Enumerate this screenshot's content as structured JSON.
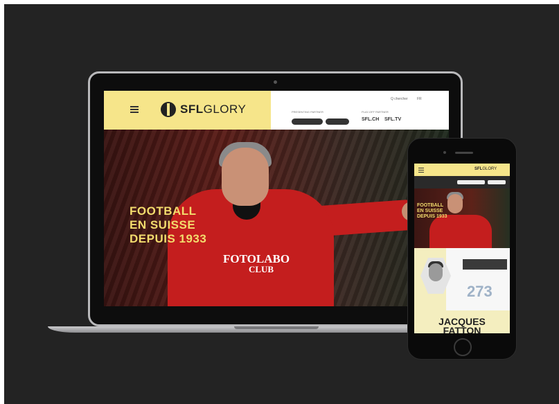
{
  "colors": {
    "brand_yellow": "#f6e58a",
    "hero_text": "#f3dc6d",
    "shirt_red": "#c41e1e",
    "background": "#232323",
    "stat_number": "#9fb2c7"
  },
  "desktop": {
    "menu_icon": "hamburger-icon",
    "logo": {
      "icon": "sfl-shield-icon",
      "bold": "SFL",
      "light": "GLORY"
    },
    "search_label": "Q chercher",
    "lang_label": "FR",
    "partner_label": "PRESENTING PARTNER",
    "partners": [
      "",
      ""
    ],
    "playoff_label": "PLAY-OFF PARTNER",
    "sfl_link": "SFL.CH",
    "sfl_tv": "SFL.TV",
    "hero": {
      "title_line1": "FOOTBALL",
      "title_line2": "EN SUISSE",
      "title_line3": "DEPUIS 1933",
      "subtitle": "",
      "shirt_sponsor_1": "FOTOLABO",
      "shirt_sponsor_2": "CLUB"
    }
  },
  "mobile": {
    "menu_icon": "hamburger-icon",
    "logo": {
      "bold": "SFL",
      "light": "GLORY"
    },
    "partner_label": "",
    "pills": [
      "",
      ""
    ],
    "hero": {
      "title_line1": "FOOTBALL",
      "title_line2": "EN SUISSE",
      "title_line3": "DEPUIS 1933"
    },
    "stat": {
      "label": "",
      "value": "273",
      "caption": "",
      "name_line1": "JACQUES",
      "name_line2": "FATTON"
    }
  }
}
